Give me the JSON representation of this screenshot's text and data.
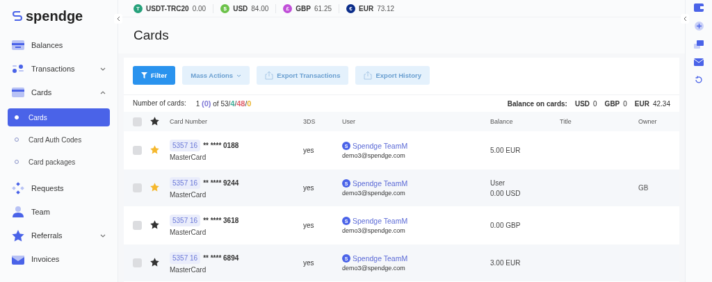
{
  "logo": "spendge",
  "sidebar": {
    "items": [
      {
        "label": "Balances",
        "selected": false
      },
      {
        "label": "Transactions",
        "selected": false,
        "expanded": false
      },
      {
        "label": "Cards",
        "selected": false,
        "expanded": true,
        "children": [
          {
            "label": "Cards",
            "selected": true
          },
          {
            "label": "Card Auth Codes",
            "selected": false
          },
          {
            "label": "Card packages",
            "selected": false
          }
        ]
      },
      {
        "label": "Requests",
        "selected": false
      },
      {
        "label": "Team",
        "selected": false
      },
      {
        "label": "Referrals",
        "selected": false,
        "expanded": false
      },
      {
        "label": "Invoices",
        "selected": false
      }
    ]
  },
  "balances": [
    {
      "symbol": "T",
      "currency": "USDT-TRC20",
      "amount": "0.00",
      "color": "#26a17b"
    },
    {
      "symbol": "$",
      "currency": "USD",
      "amount": "84.00",
      "color": "#6cc24a"
    },
    {
      "symbol": "£",
      "currency": "GBP",
      "amount": "61.25",
      "color": "#c04fd8"
    },
    {
      "symbol": "€",
      "currency": "EUR",
      "amount": "73.12",
      "color": "#0b2d8a"
    }
  ],
  "page_title": "Cards",
  "toolbar": [
    {
      "label": "Filter",
      "kind": "primary"
    },
    {
      "label": "Mass Actions",
      "kind": "dropdown"
    },
    {
      "label": "Export Transactions",
      "kind": "export"
    },
    {
      "label": "Export History",
      "kind": "export"
    }
  ],
  "count": {
    "label": "Number of cards:",
    "parts": [
      {
        "text": "1 "
      },
      {
        "text": "(0)",
        "color": "#7f78d6"
      },
      {
        "text": " of 53/"
      },
      {
        "text": "4",
        "color": "#3fae9a"
      },
      {
        "text": "/"
      },
      {
        "text": "48",
        "color": "#e0606c"
      },
      {
        "text": "/"
      },
      {
        "text": "0",
        "color": "#eab530"
      }
    ]
  },
  "balance_on_cards": {
    "label": "Balance on cards:",
    "items": [
      {
        "currency": "USD",
        "amount": "0"
      },
      {
        "currency": "GBP",
        "amount": "0"
      },
      {
        "currency": "EUR",
        "amount": "42.34"
      }
    ]
  },
  "table": {
    "header_checked": false,
    "columns": [
      "Card Number",
      "3DS",
      "User",
      "Balance",
      "Title",
      "Owner"
    ],
    "rows": [
      {
        "checked": false,
        "favorite": true,
        "bin": "5357 16",
        "masked": "** **** 0188",
        "brand": "MasterCard",
        "three_ds": "yes",
        "avatar": "S",
        "user": "Spendge TeamM",
        "email": "demo3@spendge.com",
        "balance": [
          "5.00 EUR"
        ]
      },
      {
        "checked": false,
        "favorite": true,
        "bin": "5357 16",
        "masked": "** **** 9244",
        "brand": "MasterCard",
        "three_ds": "yes",
        "avatar": "S",
        "user": "Spendge TeamM",
        "email": "demo3@spendge.com",
        "balance": [
          "User",
          "0.00 USD"
        ],
        "owner": "GB"
      },
      {
        "checked": false,
        "favorite": false,
        "bin": "5357 16",
        "masked": "** **** 3618",
        "brand": "MasterCard",
        "three_ds": "yes",
        "avatar": "S",
        "user": "Spendge TeamM",
        "email": "demo3@spendge.com",
        "balance": [
          "0.00 GBP"
        ]
      },
      {
        "checked": false,
        "favorite": false,
        "bin": "5357 16",
        "masked": "** **** 6894",
        "brand": "MasterCard",
        "three_ds": "yes",
        "avatar": "S",
        "user": "Spendge TeamM",
        "email": "demo3@spendge.com",
        "balance": [
          "3.00 EUR"
        ]
      }
    ]
  }
}
